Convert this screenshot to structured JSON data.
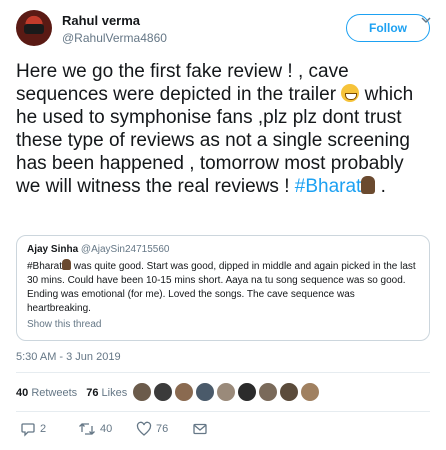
{
  "header": {
    "name": "Rahul verma",
    "handle": "@RahulVerma4860",
    "follow_label": "Follow"
  },
  "tweet": {
    "part1": "Here we go the first fake review ! , cave sequences were depicted in the trailer ",
    "part2": " which he used to symphonise fans ,plz plz dont trust these type of reviews as not a single screening has been happened , tomorrow most probably we will witness the real reviews ! ",
    "hashtag": "#Bharat",
    "end": " ."
  },
  "quote": {
    "name": "Ajay Sinha",
    "handle": "@AjaySin24715560",
    "hashtag": "#Bharat",
    "text": " was quite good. Start was good, dipped in middle and again picked in the last 30 mins. Could have been 10-15 mins short. Aaya na tu song sequence was so good. Ending was emotional (for me). Loved the songs. The cave sequence was heartbreaking.",
    "show_thread": "Show this thread"
  },
  "timestamp": "5:30 AM - 3 Jun 2019",
  "stats": {
    "retweets_count": "40",
    "retweets_label": "Retweets",
    "likes_count": "76",
    "likes_label": "Likes"
  },
  "likers": [
    "#6b5b4b",
    "#3b3b3b",
    "#8a6a50",
    "#4a5a6a",
    "#9a8a7a",
    "#2b2b2b",
    "#7a6a5a",
    "#5b4b3b",
    "#a08060"
  ],
  "actions": {
    "reply_count": "2",
    "retweet_count": "40",
    "like_count": "76"
  },
  "colors": {
    "accent": "#1da1f2",
    "muted": "#657786",
    "text": "#14171a",
    "border": "#e6ecf0"
  }
}
